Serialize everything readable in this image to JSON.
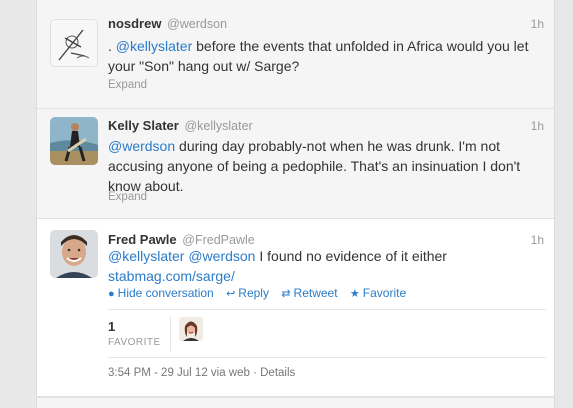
{
  "tweets": [
    {
      "fullname": "nosdrew",
      "username": "@werdson",
      "time": "1h",
      "text_prefix": ". ",
      "mention": "@kellyslater",
      "text_rest": " before the events that unfolded in Africa would you let your \"Son\" hang out w/ Sarge?",
      "expand": "Expand"
    },
    {
      "fullname": "Kelly Slater",
      "username": "@kellyslater",
      "time": "1h",
      "mention": "@werdson",
      "text_rest": " during day probably-not when he was drunk. I'm not accusing anyone of being a pedophile. That's an insinuation I don't know about.",
      "expand": "Expand"
    },
    {
      "fullname": "Fred Pawle",
      "username": "@FredPawle",
      "time": "1h",
      "mention1": "@kellyslater",
      "mention2": "@werdson",
      "text_rest": " I found no evidence of it either",
      "link": "stabmag.com/sarge/",
      "actions": {
        "hide": "Hide conversation",
        "reply": "Reply",
        "retweet": "Retweet",
        "favorite": "Favorite"
      },
      "stats": {
        "favorites_count": "1",
        "favorites_label": "FAVORITE"
      },
      "meta": "3:54 PM - 29 Jul 12 via web · Details"
    }
  ],
  "icons": {
    "hide": "speech-bubble-icon",
    "reply": "reply-arrow-icon",
    "retweet": "retweet-icon",
    "favorite": "star-icon"
  },
  "colors": {
    "link": "#2a7cc9",
    "name": "#333333",
    "muted": "#999999",
    "collapsed_bg": "#f5f5f5"
  }
}
